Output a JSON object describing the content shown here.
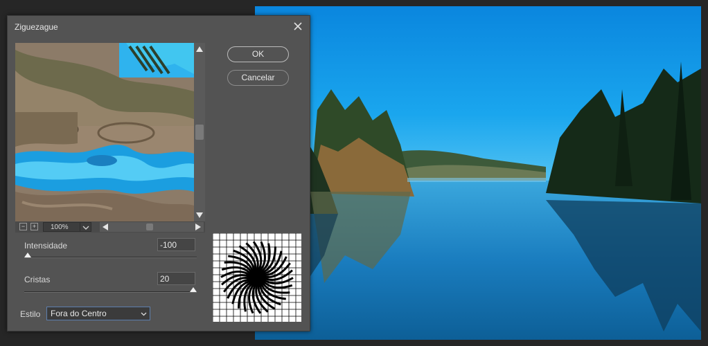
{
  "dialog": {
    "title": "Ziguezague",
    "ok_label": "OK",
    "cancel_label": "Cancelar"
  },
  "preview": {
    "zoom_value": "100%",
    "zoom_out_glyph": "−",
    "zoom_in_glyph": "+"
  },
  "params": {
    "intensidade_label": "Intensidade",
    "intensidade_value": "-100",
    "intensidade_fraction": 0.0,
    "cristas_label": "Cristas",
    "cristas_value": "20",
    "cristas_fraction": 1.0,
    "estilo_label": "Estilo",
    "estilo_value": "Fora do Centro"
  },
  "icons": {
    "close": "close-icon",
    "scroll_up": "triangle-up-icon",
    "scroll_down": "triangle-down-icon",
    "scroll_left": "triangle-left-icon",
    "scroll_right": "triangle-right-icon",
    "dropdown": "chevron-down-icon"
  },
  "colors": {
    "dialog_bg": "#535353",
    "sky": "#0b8fe6",
    "water": "#0a6fb0",
    "focus_border": "#5d7fae"
  }
}
